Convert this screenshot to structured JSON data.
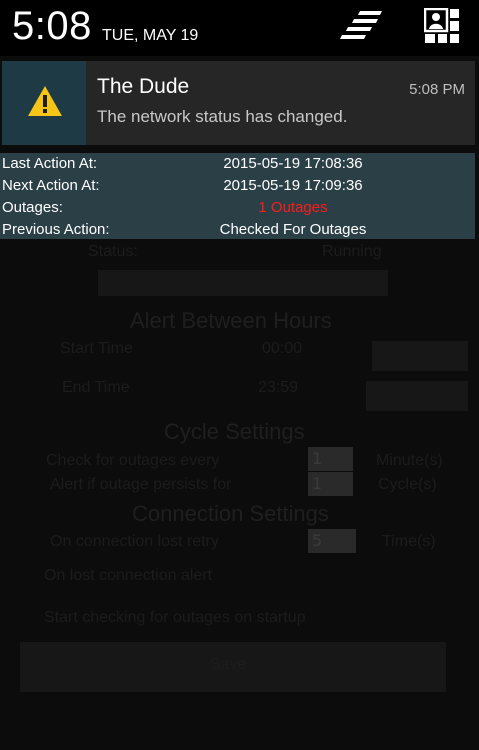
{
  "status_bar": {
    "time": "5:08",
    "date": "TUE, MAY 19",
    "icons": [
      "settings-sliders-icon",
      "user-profile-icon"
    ]
  },
  "notification": {
    "title": "The Dude",
    "time": "5:08 PM",
    "text": "The network status has changed.",
    "icon": "warning-icon",
    "accent": "#1e3a45",
    "warning_color": "#f5c518"
  },
  "info_panel": {
    "rows": [
      {
        "label": "Last Action At:",
        "value": "2015-05-19 17:08:36"
      },
      {
        "label": "Next Action At:",
        "value": "2015-05-19 17:09:36"
      },
      {
        "label": "Outages:",
        "value": "1 Outages"
      },
      {
        "label": "Previous Action:",
        "value": "Checked For Outages"
      }
    ],
    "outage_color": "#ff1a1a",
    "background": "#2b3f47"
  },
  "background_app": {
    "status_label": "Status:",
    "status_value": "Running",
    "alert_header": "Alert Between Hours",
    "start_label": "Start Time",
    "start_value": "00:00",
    "end_label": "End Time",
    "end_value": "23:59",
    "cycle_header": "Cycle Settings",
    "check_label": "Check for outages every",
    "check_value": "1",
    "check_unit": "Minute(s)",
    "persist_label": "Alert if outage persists for",
    "persist_value": "1",
    "persist_unit": "Cycle(s)",
    "connection_header": "Connection Settings",
    "retry_label": "On connection lost retry",
    "retry_value": "5",
    "retry_unit": "Time(s)",
    "lost_alert_label": "On lost connection alert",
    "startup_label": "Start checking for outages on startup",
    "save_label": "Save"
  }
}
